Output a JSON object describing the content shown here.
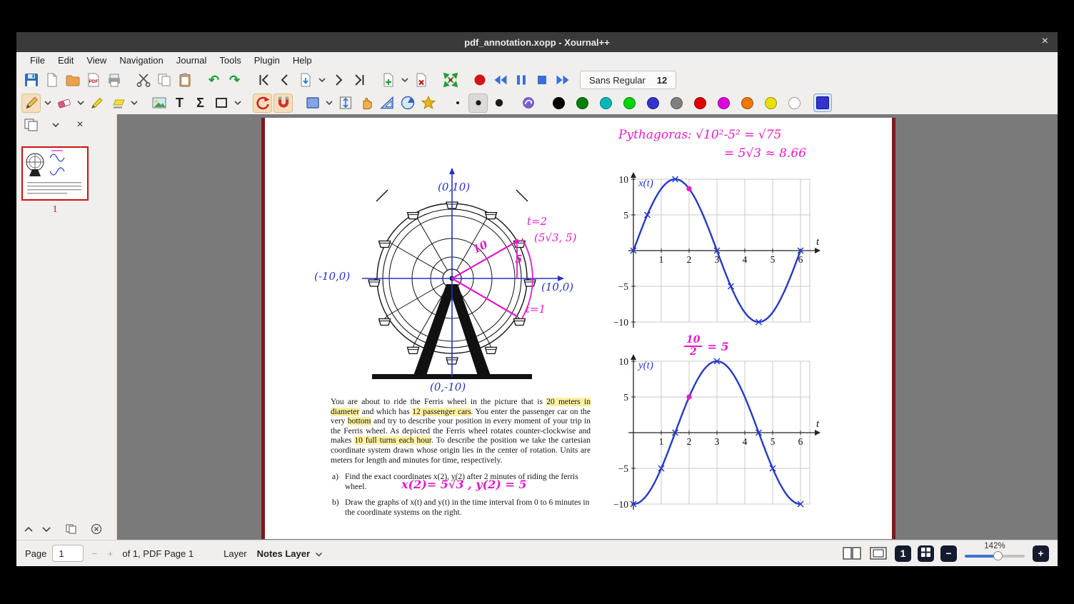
{
  "window": {
    "title": "pdf_annotation.xopp - Xournal++",
    "close_glyph": "×"
  },
  "menubar": {
    "items": [
      "File",
      "Edit",
      "View",
      "Navigation",
      "Journal",
      "Tools",
      "Plugin",
      "Help"
    ]
  },
  "toolbar1": {
    "font_name": "Sans Regular",
    "font_size": "12",
    "buttons": [
      {
        "name": "save",
        "kind": "floppy"
      },
      {
        "name": "new-document",
        "kind": "page"
      },
      {
        "name": "open-file",
        "kind": "folder"
      },
      {
        "name": "export-pdf",
        "kind": "pdf",
        "glyph": "PDF"
      },
      {
        "name": "print",
        "kind": "printer",
        "sep_after": true
      },
      {
        "name": "cut",
        "kind": "scissors"
      },
      {
        "name": "copy",
        "kind": "copy"
      },
      {
        "name": "paste",
        "kind": "clipboard",
        "sep_after": true
      },
      {
        "name": "undo",
        "kind": "glyph",
        "glyph": "↶",
        "color": "#1d9e33",
        "bold": true
      },
      {
        "name": "redo",
        "kind": "glyph",
        "glyph": "↷",
        "color": "#1d9e33",
        "bold": true,
        "sep_after": true
      },
      {
        "name": "first-page",
        "kind": "nav-first"
      },
      {
        "name": "previous-page",
        "kind": "nav-prev"
      },
      {
        "name": "goto-page",
        "kind": "page-goto"
      },
      {
        "name": "goto-page-dropdown",
        "kind": "dd"
      },
      {
        "name": "next-page",
        "kind": "nav-next"
      },
      {
        "name": "last-page",
        "kind": "nav-last",
        "sep_after": true
      },
      {
        "name": "add-page",
        "kind": "page-add"
      },
      {
        "name": "add-page-dropdown",
        "kind": "dd"
      },
      {
        "name": "delete-page",
        "kind": "page-del",
        "sep_after": true
      },
      {
        "name": "zoom-fit",
        "kind": "zoom-fit",
        "sep_after": true
      },
      {
        "name": "record-audio",
        "kind": "record"
      },
      {
        "name": "rewind-audio",
        "kind": "rew"
      },
      {
        "name": "pause-audio",
        "kind": "pause"
      },
      {
        "name": "stop-audio",
        "kind": "stop"
      },
      {
        "name": "forward-audio",
        "kind": "fwd"
      }
    ]
  },
  "toolbar2": {
    "buttons": [
      {
        "name": "pen-tool",
        "kind": "pencil",
        "active": true
      },
      {
        "name": "pen-options-dropdown",
        "kind": "dd"
      },
      {
        "name": "eraser-tool",
        "kind": "eraser"
      },
      {
        "name": "eraser-options-dropdown",
        "kind": "dd"
      },
      {
        "name": "highlighter-tool",
        "kind": "marker"
      },
      {
        "name": "highlighter-alt-tool",
        "kind": "flatmarker"
      },
      {
        "name": "highlighter-options-dropdown",
        "kind": "dd",
        "sep_after": true
      },
      {
        "name": "insert-image-tool",
        "kind": "image"
      },
      {
        "name": "text-tool",
        "kind": "glyph",
        "glyph": "T",
        "color": "#222",
        "bold": true
      },
      {
        "name": "math-tex-tool",
        "kind": "glyph",
        "glyph": "Σ",
        "color": "#222",
        "bold": true
      },
      {
        "name": "shape-tool",
        "kind": "shape-square"
      },
      {
        "name": "shape-options-dropdown",
        "kind": "dd",
        "sep_after": true
      },
      {
        "name": "shape-recognizer-tool",
        "kind": "shape-recog",
        "active": true
      },
      {
        "name": "snap-to-grid-tool",
        "kind": "magnet",
        "active": true,
        "sep_after": true
      },
      {
        "name": "select-rectangle-tool",
        "kind": "select-rect"
      },
      {
        "name": "select-options-dropdown",
        "kind": "dd"
      },
      {
        "name": "vertical-space-tool",
        "kind": "vspace"
      },
      {
        "name": "hand-tool",
        "kind": "hand"
      },
      {
        "name": "setsquare-tool",
        "kind": "setsquare"
      },
      {
        "name": "compass-tool",
        "kind": "compass"
      },
      {
        "name": "spline-tool",
        "kind": "star",
        "sep_after": true
      },
      {
        "name": "line-width-fine",
        "kind": "dot",
        "size": 2
      },
      {
        "name": "line-width-medium",
        "kind": "dot",
        "size": 3.6,
        "pressed": true
      },
      {
        "name": "line-width-thick",
        "kind": "dot",
        "size": 5.2,
        "sep_after": true
      },
      {
        "name": "fill-tool",
        "kind": "swirl",
        "sep_after": true
      }
    ],
    "palette": [
      {
        "name": "black",
        "hex": "#000000"
      },
      {
        "name": "green",
        "hex": "#008000"
      },
      {
        "name": "cyan",
        "hex": "#00b8b8"
      },
      {
        "name": "light-green",
        "hex": "#00d400"
      },
      {
        "name": "blue",
        "hex": "#3333cc"
      },
      {
        "name": "gray",
        "hex": "#808080"
      },
      {
        "name": "red",
        "hex": "#e00000"
      },
      {
        "name": "magenta",
        "hex": "#dd00dd"
      },
      {
        "name": "orange",
        "hex": "#f07800"
      },
      {
        "name": "yellow",
        "hex": "#ebe000"
      },
      {
        "name": "white",
        "hex": "#ffffff"
      }
    ],
    "current_color": "#3333cc"
  },
  "sidebar": {
    "selected_page_number": "1",
    "close_glyph": "×"
  },
  "page": {
    "wheel_labels": {
      "top": "(0,10)",
      "left": "(-10,0)",
      "right": "(10,0)",
      "bottom": "(0,-10)"
    },
    "ink": {
      "t2": "t=2",
      "point_coords": "(5√3, 5)",
      "radius_label": "10",
      "height_label": "5",
      "t1": "t=1",
      "pythagoras_line1": "Pythagoras: √10²-5² = √75",
      "pythagoras_line2": "= 5√3 ≈ 8.66",
      "answer_a": "x(2)= 5√3 , y(2) = 5",
      "fraction_numerator": "10",
      "fraction_denominator": "2",
      "fraction_result": "= 5"
    },
    "problem_segments": [
      {
        "t": "You are about to ride the Ferris wheel in the picture that is "
      },
      {
        "t": "20 meters in diameter",
        "hl": true
      },
      {
        "t": " and which has "
      },
      {
        "t": "12 passenger cars",
        "hl": true
      },
      {
        "t": ".  You enter the passenger car on the very "
      },
      {
        "t": "bottom",
        "hl": true
      },
      {
        "t": " and try to describe your position in every moment of your trip in the Ferris wheel.  As depicted the Ferris wheel rotates counter-clockwise and makes "
      },
      {
        "t": "10 full turns each hour",
        "hl": true
      },
      {
        "t": ".  To describe the position we take the cartesian coordinate system drawn whose origin lies in the center of rotation.  Units are meters for length and minutes for time, respectively."
      }
    ],
    "items": [
      {
        "label": "a)",
        "text": "Find the exact coordinates x(2), y(2) after 2 minutes of riding the ferris wheel."
      },
      {
        "label": "b)",
        "text": "Draw the graphs of x(t) and y(t) in the time interval from 0 to 6 minutes in the coordinate systems on the right."
      }
    ]
  },
  "chart_data": [
    {
      "type": "line",
      "title": "x(t)",
      "xlabel": "t",
      "x_range": [
        0,
        6
      ],
      "y_range": [
        -10,
        10
      ],
      "x_ticks": [
        1,
        2,
        3,
        4,
        5,
        6
      ],
      "y_ticks": [
        10,
        5,
        -5,
        -10
      ],
      "function": "x(t) = 10·sin(π·t/3)",
      "kind": "sin",
      "amplitude": 10,
      "period": 6,
      "curve_color": "#2638c8",
      "grid": true,
      "cross_marks": [
        [
          0,
          0
        ],
        [
          0.5,
          5
        ],
        [
          1.5,
          10
        ],
        [
          3,
          0
        ],
        [
          3.5,
          -5
        ],
        [
          4.5,
          -10
        ],
        [
          6,
          0
        ]
      ],
      "highlight_point": {
        "t": 2,
        "value": 8.66,
        "color": "#e619c9"
      }
    },
    {
      "type": "line",
      "title": "y(t)",
      "xlabel": "t",
      "x_range": [
        0,
        6
      ],
      "y_range": [
        -10,
        10
      ],
      "x_ticks": [
        1,
        2,
        3,
        4,
        5,
        6
      ],
      "y_ticks": [
        10,
        5,
        -5,
        -10
      ],
      "function": "y(t) = -10·cos(π·t/3)",
      "kind": "neg-cos",
      "amplitude": 10,
      "period": 6,
      "curve_color": "#2638c8",
      "grid": true,
      "cross_marks": [
        [
          0,
          -10
        ],
        [
          1,
          -5
        ],
        [
          1.5,
          0
        ],
        [
          3,
          10
        ],
        [
          4.5,
          0
        ],
        [
          5,
          -5
        ],
        [
          6,
          -10
        ]
      ],
      "highlight_point": {
        "t": 2,
        "value": 5,
        "color": "#e619c9"
      }
    }
  ],
  "statusbar": {
    "page_label": "Page",
    "page_value": "1",
    "decrement_glyph": "−",
    "increment_glyph": "+",
    "of_text": "of 1, PDF Page 1",
    "layer_label": "Layer",
    "layer_value": "Notes Layer",
    "zoom_percent": "142%",
    "badge_page": "1",
    "badge_minus": "−",
    "badge_plus": "+"
  }
}
